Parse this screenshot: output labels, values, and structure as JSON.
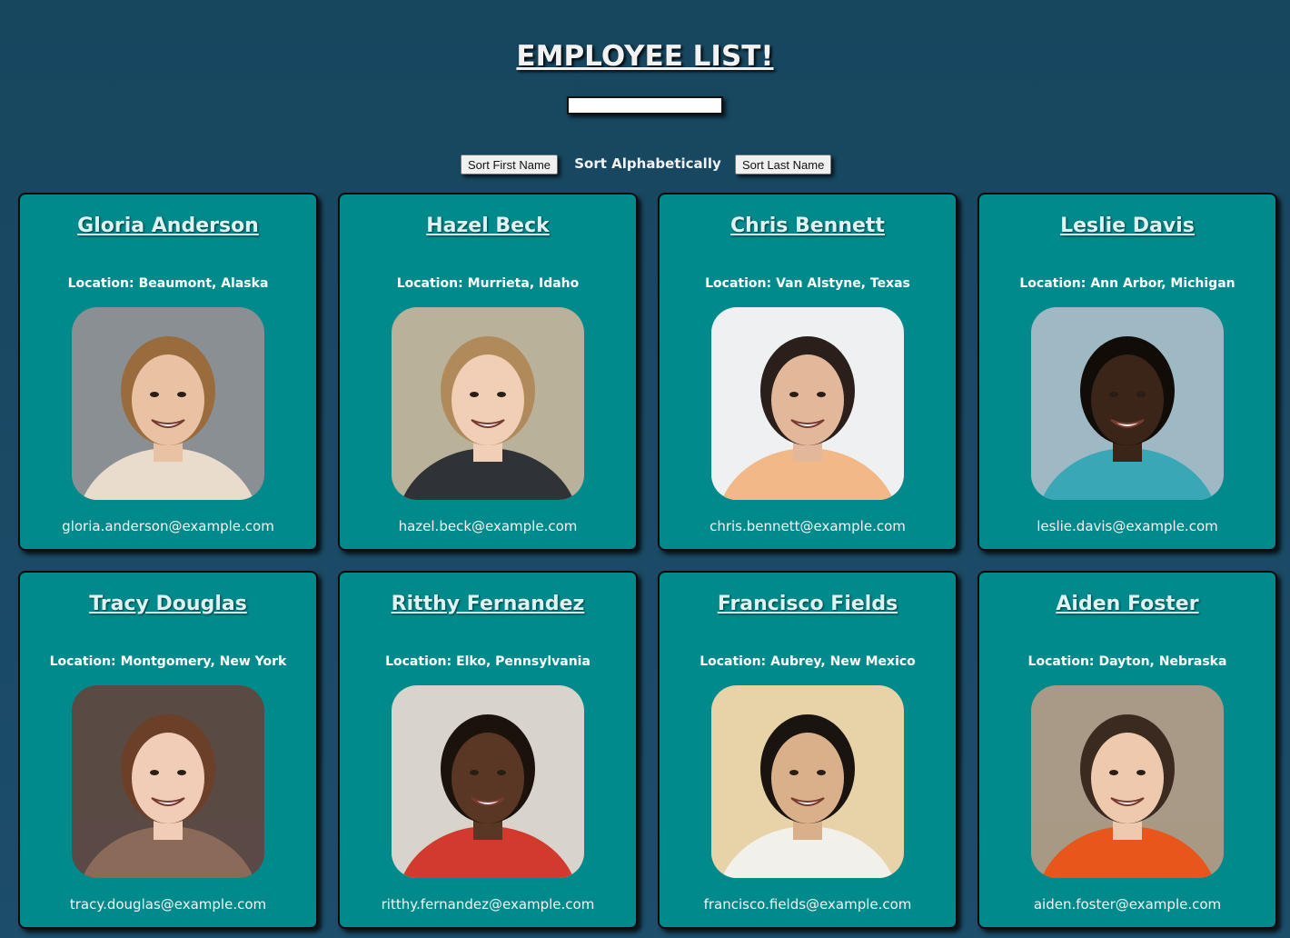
{
  "header": {
    "title": "EMPLOYEE LIST!",
    "search_placeholder": ""
  },
  "sort": {
    "first_name_label": "Sort First Name",
    "middle_label": "Sort Alphabetically",
    "last_name_label": "Sort Last Name"
  },
  "location_prefix": "Location:",
  "employees": [
    {
      "name": "Gloria Anderson",
      "location": "Beaumont, Alaska",
      "email": "gloria.anderson@example.com"
    },
    {
      "name": "Hazel Beck",
      "location": "Murrieta, Idaho",
      "email": "hazel.beck@example.com"
    },
    {
      "name": "Chris Bennett",
      "location": "Van Alstyne, Texas",
      "email": "chris.bennett@example.com"
    },
    {
      "name": "Leslie Davis",
      "location": "Ann Arbor, Michigan",
      "email": "leslie.davis@example.com"
    },
    {
      "name": "Tracy Douglas",
      "location": "Montgomery, New York",
      "email": "tracy.douglas@example.com"
    },
    {
      "name": "Ritthy Fernandez",
      "location": "Elko, Pennsylvania",
      "email": "ritthy.fernandez@example.com"
    },
    {
      "name": "Francisco Fields",
      "location": "Aubrey, New Mexico",
      "email": "francisco.fields@example.com"
    },
    {
      "name": "Aiden Foster",
      "location": "Dayton, Nebraska",
      "email": "aiden.foster@example.com"
    }
  ],
  "photo_palettes": [
    {
      "bg": "#8a8f93",
      "skin": "#e9c2a3",
      "hair": "#9a6b3c",
      "shirt": "#eadccc"
    },
    {
      "bg": "#b9b19a",
      "skin": "#f0cfb6",
      "hair": "#b08a5a",
      "shirt": "#2f3338"
    },
    {
      "bg": "#eef0f2",
      "skin": "#e3b89a",
      "hair": "#2a1f1a",
      "shirt": "#f2b887"
    },
    {
      "bg": "#9fb9c4",
      "skin": "#3b2418",
      "hair": "#120c08",
      "shirt": "#3aa7b6"
    },
    {
      "bg": "#5a4a44",
      "skin": "#f1cdb8",
      "hair": "#6b3f28",
      "shirt": "#8c6a5a"
    },
    {
      "bg": "#d8d4cc",
      "skin": "#5a3724",
      "hair": "#1c120c",
      "shirt": "#d23a2e"
    },
    {
      "bg": "#e8d2a8",
      "skin": "#d9b08a",
      "hair": "#1a1410",
      "shirt": "#f2f0ea"
    },
    {
      "bg": "#a89a86",
      "skin": "#efc9ad",
      "hair": "#3a2a20",
      "shirt": "#e8561c"
    }
  ]
}
